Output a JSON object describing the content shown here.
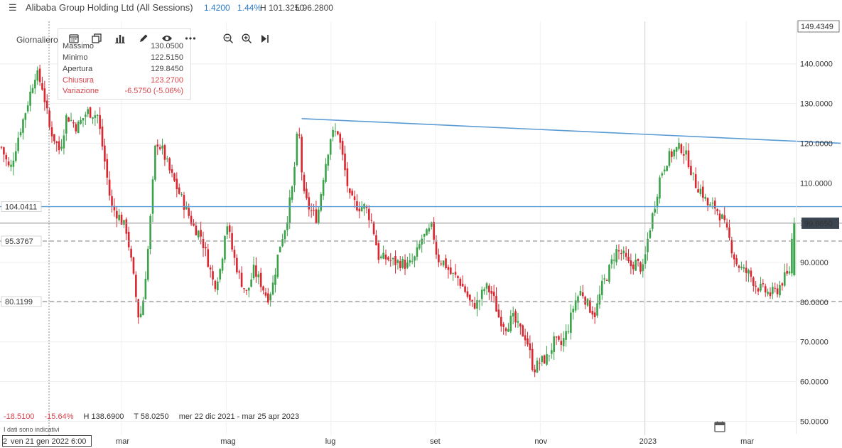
{
  "header": {
    "title": "Alibaba Group Holding Ltd (All Sessions)",
    "change": "1.4200",
    "change_pct": "1.44%",
    "high": "H 101.3250",
    "low": "L 96.2800"
  },
  "toolbar": {
    "period_label": "Giornaliero",
    "icons": [
      "calendar-icon",
      "copy-icon",
      "bar-chart-icon",
      "pencil-icon",
      "eye-icon",
      "more-icon",
      "zoom-out-icon",
      "zoom-in-icon",
      "play-icon"
    ]
  },
  "tooltip": {
    "rows": [
      {
        "key": "Massimo",
        "value": "130.0500"
      },
      {
        "key": "Minimo",
        "value": "122.5150"
      },
      {
        "key": "Apertura",
        "value": "129.8450"
      },
      {
        "key": "Chiusura",
        "value": "123.2700"
      },
      {
        "key": "Variazione",
        "value": "-6.5750 (-5.06%)"
      }
    ]
  },
  "bottom": {
    "change": "-18.5100",
    "change_pct": "-15.64%",
    "high": "H 138.6900",
    "low": "T 58.0250",
    "range": "mer 22 dic 2021 - mar 25 apr 2023",
    "disclaimer": "I dati sono indicativi",
    "cursor_date_prefix": "2",
    "cursor_date": "ven 21 gen 2022 6:00"
  },
  "colors": {
    "up": "#3aa34a",
    "down": "#d9262f",
    "trendline": "#5b9bd5",
    "dashed": "#999999",
    "accent": "#2a7ac7"
  },
  "chart_data": {
    "type": "candlestick",
    "y_axis": {
      "ticks": [
        "140.0000",
        "130.0000",
        "120.0000",
        "110.0000",
        "100.0000",
        "90.0000",
        "80.0000",
        "70.0000",
        "60.0000",
        "50.0000"
      ],
      "tick_values": [
        140,
        130,
        120,
        110,
        100,
        90,
        80,
        70,
        60,
        50
      ],
      "ylim": [
        46.5,
        149.4349
      ],
      "top_label": "149.4349",
      "current_price_label": "99.8650",
      "current_price": 99.865
    },
    "x_axis": {
      "labels": [
        "mar",
        "mag",
        "lug",
        "set",
        "nov",
        "2023",
        "mar"
      ],
      "label_days": [
        70,
        131,
        192,
        253,
        314,
        375,
        434
      ],
      "total_days": 489
    },
    "horizontal_lines": [
      {
        "label": "104.0411",
        "value": 104.0411,
        "style": "solid"
      },
      {
        "label": "95.3767",
        "value": 95.3767,
        "style": "dashed"
      },
      {
        "label": "80.1199",
        "value": 80.1199,
        "style": "dashed"
      }
    ],
    "trendline": {
      "from": [
        175,
        126.2
      ],
      "to": [
        489,
        120
      ]
    },
    "price_path": [
      [
        0,
        119
      ],
      [
        5,
        113
      ],
      [
        10,
        122
      ],
      [
        14,
        128
      ],
      [
        20,
        138
      ],
      [
        24,
        134
      ],
      [
        28,
        124
      ],
      [
        34,
        118
      ],
      [
        38,
        127
      ],
      [
        44,
        124
      ],
      [
        50,
        128
      ],
      [
        56,
        127
      ],
      [
        60,
        116
      ],
      [
        64,
        104
      ],
      [
        68,
        102
      ],
      [
        73,
        98
      ],
      [
        77,
        86
      ],
      [
        80,
        76
      ],
      [
        82,
        78
      ],
      [
        86,
        96
      ],
      [
        90,
        121
      ],
      [
        94,
        118
      ],
      [
        98,
        113
      ],
      [
        103,
        108
      ],
      [
        108,
        103
      ],
      [
        112,
        99
      ],
      [
        116,
        97
      ],
      [
        120,
        91
      ],
      [
        124,
        84
      ],
      [
        128,
        89
      ],
      [
        131,
        101
      ],
      [
        135,
        92
      ],
      [
        139,
        86
      ],
      [
        143,
        82
      ],
      [
        147,
        88
      ],
      [
        151,
        85
      ],
      [
        155,
        81
      ],
      [
        158,
        84
      ],
      [
        162,
        94
      ],
      [
        166,
        100
      ],
      [
        170,
        110
      ],
      [
        173,
        125
      ],
      [
        176,
        107
      ],
      [
        180,
        103
      ],
      [
        184,
        101
      ],
      [
        188,
        113
      ],
      [
        192,
        122
      ],
      [
        196,
        123
      ],
      [
        199,
        116
      ],
      [
        203,
        106
      ],
      [
        208,
        104
      ],
      [
        212,
        104
      ],
      [
        216,
        100
      ],
      [
        220,
        91
      ],
      [
        225,
        91
      ],
      [
        229,
        90
      ],
      [
        233,
        90
      ],
      [
        237,
        89
      ],
      [
        241,
        91
      ],
      [
        245,
        96
      ],
      [
        248,
        97
      ],
      [
        251,
        99
      ],
      [
        254,
        91
      ],
      [
        258,
        90
      ],
      [
        262,
        87
      ],
      [
        266,
        86
      ],
      [
        270,
        83
      ],
      [
        274,
        79
      ],
      [
        278,
        80
      ],
      [
        282,
        84
      ],
      [
        286,
        82
      ],
      [
        290,
        76
      ],
      [
        294,
        74
      ],
      [
        298,
        76
      ],
      [
        302,
        73
      ],
      [
        306,
        71
      ],
      [
        310,
        63
      ],
      [
        314,
        65
      ],
      [
        318,
        66
      ],
      [
        322,
        70
      ],
      [
        326,
        69
      ],
      [
        330,
        73
      ],
      [
        334,
        80
      ],
      [
        338,
        83
      ],
      [
        342,
        79
      ],
      [
        346,
        77
      ],
      [
        350,
        84
      ],
      [
        354,
        88
      ],
      [
        358,
        93
      ],
      [
        362,
        92
      ],
      [
        366,
        89
      ],
      [
        370,
        90
      ],
      [
        374,
        88
      ],
      [
        377,
        97
      ],
      [
        380,
        103
      ],
      [
        384,
        112
      ],
      [
        388,
        116
      ],
      [
        392,
        118
      ],
      [
        396,
        119
      ],
      [
        400,
        116
      ],
      [
        404,
        110
      ],
      [
        408,
        108
      ],
      [
        412,
        104
      ],
      [
        416,
        104
      ],
      [
        420,
        101
      ],
      [
        424,
        96
      ],
      [
        428,
        90
      ],
      [
        432,
        88
      ],
      [
        436,
        87
      ],
      [
        440,
        84
      ],
      [
        444,
        83
      ],
      [
        448,
        82
      ],
      [
        452,
        83
      ],
      [
        456,
        86
      ],
      [
        459,
        87
      ],
      [
        461,
        98
      ],
      [
        462,
        99.865
      ]
    ]
  }
}
